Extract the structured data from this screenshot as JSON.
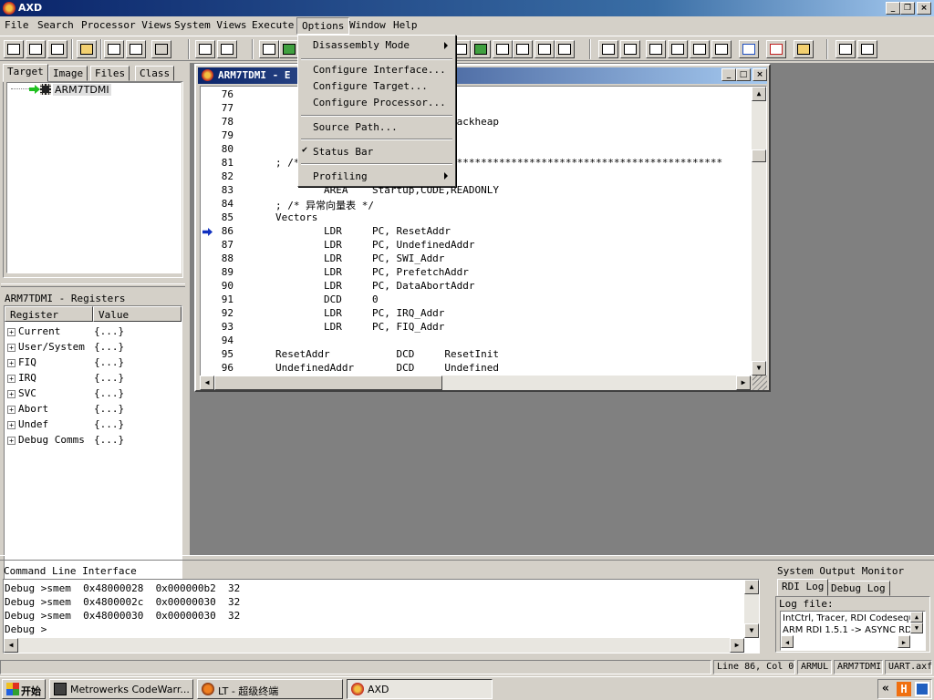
{
  "window": {
    "title": "AXD"
  },
  "menubar": [
    "File",
    "Search",
    "Processor Views",
    "System Views",
    "Execute",
    "Options",
    "Window",
    "Help"
  ],
  "options_menu": {
    "items": [
      {
        "label": "Disassembly Mode",
        "submenu": true,
        "checked": false
      },
      {
        "label": "Configure Interface...",
        "submenu": false,
        "checked": false
      },
      {
        "label": "Configure Target...",
        "submenu": false,
        "checked": false
      },
      {
        "label": "Configure Processor...",
        "submenu": false,
        "checked": false
      },
      {
        "label": "Source Path...",
        "submenu": false,
        "checked": false
      },
      {
        "label": "Status Bar",
        "submenu": false,
        "checked": true
      },
      {
        "label": "Profiling",
        "submenu": true,
        "checked": false
      }
    ]
  },
  "left_tabs": [
    "Target",
    "Image",
    "Files",
    "Class"
  ],
  "target_tree": {
    "node": "ARM7TDMI"
  },
  "registers": {
    "title": "ARM7TDMI - Registers",
    "columns": [
      "Register",
      "Value"
    ],
    "rows": [
      {
        "name": "Current",
        "value": "{...}"
      },
      {
        "name": "User/System",
        "value": "{...}"
      },
      {
        "name": "FIQ",
        "value": "{...}"
      },
      {
        "name": "IRQ",
        "value": "{...}"
      },
      {
        "name": "SVC",
        "value": "{...}"
      },
      {
        "name": "Abort",
        "value": "{...}"
      },
      {
        "name": "Undef",
        "value": "{...}"
      },
      {
        "name": "Debug Comms",
        "value": "{...}"
      }
    ]
  },
  "code_window": {
    "title": "ARM7TDMI - E",
    "lines": [
      {
        "n": "76",
        "t": ""
      },
      {
        "n": "77",
        "t": ""
      },
      {
        "n": "78",
        "t": "                         al_stackheap"
      },
      {
        "n": "79",
        "t": ""
      },
      {
        "n": "80",
        "t": ""
      },
      {
        "n": "81",
        "t": "; /*                      ************************************************"
      },
      {
        "n": "82",
        "t": ""
      },
      {
        "n": "83",
        "t": "        AREA    Startup,CODE,READONLY"
      },
      {
        "n": "84",
        "t": "; /* 异常向量表 */"
      },
      {
        "n": "85",
        "t": "Vectors"
      },
      {
        "n": "86",
        "t": "        LDR     PC, ResetAddr"
      },
      {
        "n": "87",
        "t": "        LDR     PC, UndefinedAddr"
      },
      {
        "n": "88",
        "t": "        LDR     PC, SWI_Addr"
      },
      {
        "n": "89",
        "t": "        LDR     PC, PrefetchAddr"
      },
      {
        "n": "90",
        "t": "        LDR     PC, DataAbortAddr"
      },
      {
        "n": "91",
        "t": "        DCD     0"
      },
      {
        "n": "92",
        "t": "        LDR     PC, IRQ_Addr"
      },
      {
        "n": "93",
        "t": "        LDR     PC, FIQ_Addr"
      },
      {
        "n": "94",
        "t": ""
      },
      {
        "n": "95",
        "t": "ResetAddr           DCD     ResetInit"
      },
      {
        "n": "96",
        "t": "UndefinedAddr       DCD     Undefined"
      }
    ],
    "current_line": "86"
  },
  "cli": {
    "title": "Command Line Interface",
    "lines": [
      "Debug >smem  0x48000028  0x000000b2  32",
      "Debug >smem  0x4800002c  0x00000030  32",
      "Debug >smem  0x48000030  0x00000030  32",
      "Debug >"
    ]
  },
  "som": {
    "title": "System Output Monitor",
    "tabs": [
      "RDI Log",
      "Debug Log"
    ],
    "log_label": "Log file:",
    "log_lines": [
      "IntCtrl, Tracer, RDI Codesequ",
      "ARM RDI 1.5.1 -> ASYNC RD"
    ]
  },
  "statusbar": [
    "Line 86, Col 0",
    "ARMUL",
    "ARM7TDMI",
    "UART.axf"
  ],
  "taskbar": {
    "start": "开始",
    "tasks": [
      {
        "label": "Metrowerks CodeWarr...",
        "active": false
      },
      {
        "label": "LT - 超级终端",
        "active": false
      },
      {
        "label": "AXD",
        "active": true
      }
    ],
    "tray_chevron": "«"
  },
  "colors": {
    "titlebar_start": "#0a246a",
    "titlebar_end": "#a6caf0",
    "face": "#d4d0c8",
    "mdi": "#808080"
  }
}
